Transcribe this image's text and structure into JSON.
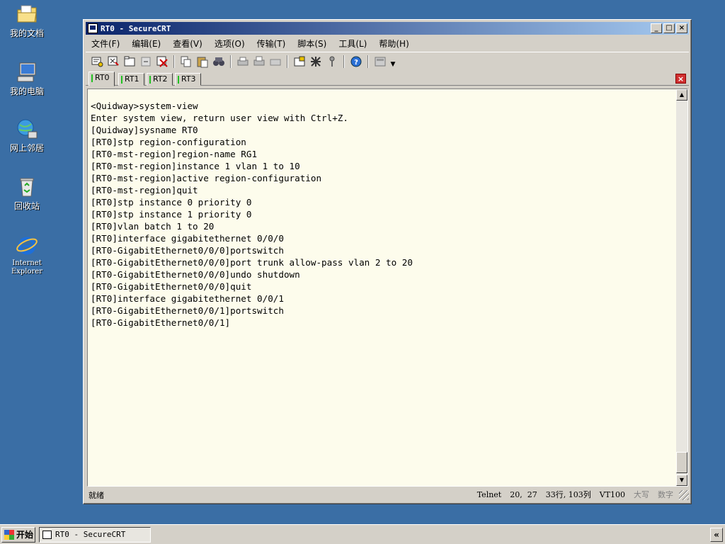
{
  "desktop": {
    "icons": [
      {
        "label": "我的文档",
        "icon": "folder-icon"
      },
      {
        "label": "我的电脑",
        "icon": "computer-icon"
      },
      {
        "label": "网上邻居",
        "icon": "network-icon"
      },
      {
        "label": "回收站",
        "icon": "recycle-bin-icon"
      },
      {
        "label_line1": "Internet",
        "label_line2": "Explorer",
        "icon": "ie-icon"
      }
    ]
  },
  "window": {
    "title": "RT0 - SecureCRT",
    "minimize": "_",
    "maximize": "□",
    "close": "×"
  },
  "menu": [
    "文件(F)",
    "编辑(E)",
    "查看(V)",
    "选项(O)",
    "传输(T)",
    "脚本(S)",
    "工具(L)",
    "帮助(H)"
  ],
  "tabs": [
    "RT0",
    "RT1",
    "RT2",
    "RT3"
  ],
  "active_tab": "RT0",
  "tab_close": "×",
  "terminal": {
    "lines": [
      "<Quidway>system-view",
      "Enter system view, return user view with Ctrl+Z.",
      "[Quidway]sysname RT0",
      "[RT0]stp region-configuration",
      "[RT0-mst-region]region-name RG1",
      "[RT0-mst-region]instance 1 vlan 1 to 10",
      "[RT0-mst-region]active region-configuration",
      "[RT0-mst-region]quit",
      "[RT0]stp instance 0 priority 0",
      "[RT0]stp instance 1 priority 0",
      "[RT0]vlan batch 1 to 20",
      "[RT0]interface gigabitethernet 0/0/0",
      "[RT0-GigabitEthernet0/0/0]portswitch",
      "[RT0-GigabitEthernet0/0/0]port trunk allow-pass vlan 2 to 20",
      "[RT0-GigabitEthernet0/0/0]undo shutdown",
      "[RT0-GigabitEthernet0/0/0]quit",
      "[RT0]interface gigabitethernet 0/0/1",
      "[RT0-GigabitEthernet0/0/1]portswitch",
      "[RT0-GigabitEthernet0/0/1]"
    ]
  },
  "status": {
    "ready": "就绪",
    "protocol": "Telnet",
    "cursor": "20,  27",
    "size": "33行, 103列",
    "emulation": "VT100",
    "caps": "大写",
    "num": "数字"
  },
  "taskbar": {
    "start": "开始",
    "task": "RT0 - SecureCRT",
    "tray_arrow": "«"
  }
}
